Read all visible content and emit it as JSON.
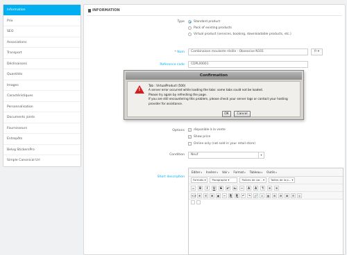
{
  "sidebar": {
    "items": [
      {
        "label": "Information",
        "active": true
      },
      {
        "label": "Prix",
        "active": false
      },
      {
        "label": "SEO",
        "active": false
      },
      {
        "label": "Associations",
        "active": false
      },
      {
        "label": "Transport",
        "active": false
      },
      {
        "label": "Déclinaisons",
        "active": false
      },
      {
        "label": "Quantités",
        "active": false
      },
      {
        "label": "Images",
        "active": false
      },
      {
        "label": "Caractéristiques",
        "active": false
      },
      {
        "label": "Personnalisation",
        "active": false
      },
      {
        "label": "Documents joints",
        "active": false
      },
      {
        "label": "Fournisseurs",
        "active": false
      },
      {
        "label": "Entrepôts",
        "active": false
      },
      {
        "label": "Belvg StickersPro",
        "active": false
      },
      {
        "label": "Simple Canonical Url",
        "active": false
      }
    ]
  },
  "panel": {
    "title": "INFORMATION",
    "type_label": "Type",
    "type_options": [
      {
        "label": "Standard product",
        "selected": true
      },
      {
        "label": "Pack of existing products",
        "selected": false
      },
      {
        "label": "Virtual product (services, booking, downloadable products, etc.)",
        "selected": false
      }
    ],
    "name_label": "Nom",
    "name_value": "Combinaison moulante résille - Obsessive N101",
    "name_lang": "fr",
    "reference_label": "Reference code",
    "reference_value": "CDPL00001",
    "options_label": "Options",
    "options": [
      {
        "label": "disponible à la vente",
        "checked": true
      },
      {
        "label": "Show price",
        "checked": true
      },
      {
        "label": "Online only (not sold in your retail store)",
        "checked": false
      }
    ],
    "condition_label": "Condition",
    "condition_value": "Neuf",
    "short_description_label": "Short description"
  },
  "editor": {
    "menus": [
      "Editer",
      "Insérer",
      "Voir",
      "Format",
      "Tableau",
      "Outils"
    ],
    "dropdowns": [
      "Formats",
      "Paragraphe",
      "Polices de car...",
      "Tailles de la p..."
    ],
    "row2_buttons": [
      "B",
      "I",
      "U",
      "S",
      "x²",
      "x₂",
      "—",
      "A",
      "A",
      "¶",
      "≡",
      "≡"
    ],
    "row3_buttons": [
      "<>",
      "≡",
      "☰",
      "⊞",
      "▣",
      "✂",
      "⎘",
      "⎗",
      "↶",
      "↷",
      "🔗",
      "⚓",
      "▦",
      "⊡",
      "⊟",
      "⊠",
      "⚙",
      "◎"
    ]
  },
  "modal": {
    "title": "Confirmation",
    "lines": [
      "Tab : VirtualProduct (500)",
      "A server error occurred while loading the tabs: some tabs could not be loaded.",
      "Please try again by refreshing the page.",
      "If you are still encountering this problem, please check your server logs or contact your hosting",
      "provider for assistance."
    ],
    "ok_label": "OK",
    "cancel_label": "Cancel"
  },
  "colors": {
    "accent": "#00aff0",
    "required": "#e03030",
    "warning": "#d21e1e"
  }
}
